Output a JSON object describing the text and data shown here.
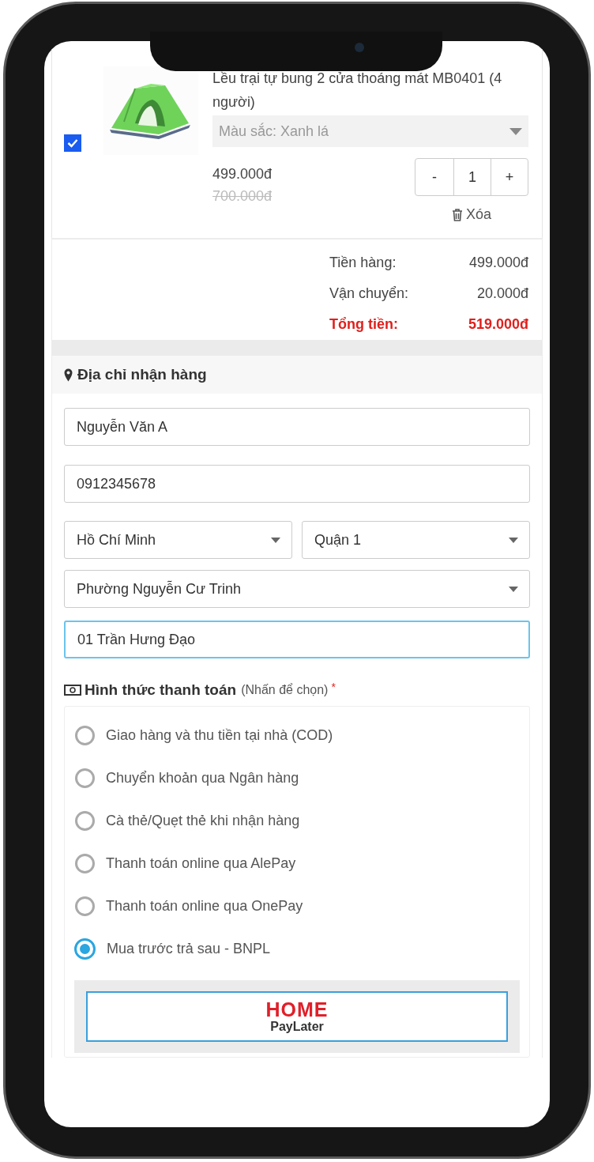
{
  "product": {
    "selected": true,
    "title": "Lều trại tự bung 2 cửa thoáng mát MB0401 (4 người)",
    "variant": "Màu sắc: Xanh lá",
    "price": "499.000đ",
    "old_price": "700.000đ",
    "decrement": "-",
    "quantity": "1",
    "increment": "+",
    "remove": "Xóa"
  },
  "summary": [
    {
      "kind": "normal",
      "label": "Tiền hàng:",
      "value": "499.000đ"
    },
    {
      "kind": "normal",
      "label": "Vận chuyển:",
      "value": "20.000đ"
    },
    {
      "kind": "total",
      "label": "Tổng tiền:",
      "value": "519.000đ"
    }
  ],
  "address": {
    "title": "Địa chỉ nhận hàng",
    "name": {
      "value": "Nguyễn Văn A"
    },
    "phone": {
      "value": "0912345678"
    },
    "province": {
      "value": "Hồ Chí Minh"
    },
    "district": {
      "value": "Quận 1"
    },
    "ward": {
      "value": "Phường Nguyễn Cư Trinh"
    },
    "street": {
      "value": "01 Trần Hưng Đạo",
      "focused": true
    }
  },
  "payment": {
    "title": "Hình thức thanh toán",
    "hint": "(Nhấn để chọn)",
    "required_mark": "*",
    "options": [
      {
        "label": "Giao hàng và thu tiền tại nhà (COD)",
        "selected": false
      },
      {
        "label": "Chuyển khoản qua Ngân hàng",
        "selected": false
      },
      {
        "label": "Cà thẻ/Quẹt thẻ khi nhận hàng",
        "selected": false
      },
      {
        "label": "Thanh toán online qua AlePay",
        "selected": false
      },
      {
        "label": "Thanh toán online qua OnePay",
        "selected": false
      },
      {
        "label": "Mua trước trả sau - BNPL",
        "selected": true
      }
    ],
    "provider": {
      "brand": "HOME",
      "sub": "PayLater"
    }
  }
}
